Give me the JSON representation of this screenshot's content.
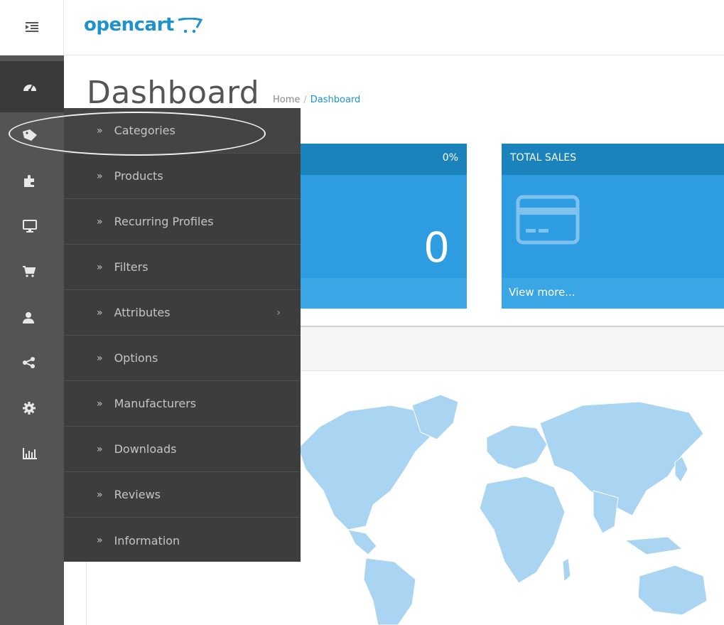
{
  "header": {
    "logo_text": "opencart",
    "brand_color": "#1e91cf"
  },
  "sidebar_icons": [
    "dashboard-icon",
    "tag-icon",
    "puzzle-icon",
    "monitor-icon",
    "cart-icon",
    "user-icon",
    "share-icon",
    "gear-icon",
    "bar-chart-icon"
  ],
  "catalog_menu": {
    "items": [
      {
        "label": "Categories",
        "has_submenu": false
      },
      {
        "label": "Products",
        "has_submenu": false
      },
      {
        "label": "Recurring Profiles",
        "has_submenu": false
      },
      {
        "label": "Filters",
        "has_submenu": false
      },
      {
        "label": "Attributes",
        "has_submenu": true
      },
      {
        "label": "Options",
        "has_submenu": false
      },
      {
        "label": "Manufacturers",
        "has_submenu": false
      },
      {
        "label": "Downloads",
        "has_submenu": false
      },
      {
        "label": "Reviews",
        "has_submenu": false
      },
      {
        "label": "Information",
        "has_submenu": false
      }
    ],
    "chevron": "»",
    "submenu_arrow": "›"
  },
  "page": {
    "title": "Dashboard",
    "breadcrumb": [
      {
        "label": "Home"
      },
      {
        "label": "Dashboard"
      }
    ],
    "breadcrumb_separator": "/"
  },
  "tiles": [
    {
      "header": "",
      "percent": "0%",
      "value": "0",
      "footer": ""
    },
    {
      "header": "TOTAL SALES",
      "icon": "credit-card-icon",
      "footer": "View more..."
    }
  ]
}
